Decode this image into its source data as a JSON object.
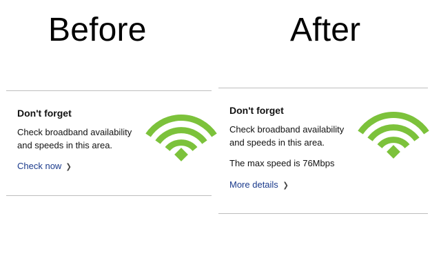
{
  "labels": {
    "before": "Before",
    "after": "After"
  },
  "before_card": {
    "title": "Don't forget",
    "text_line1": "Check broadband availability",
    "text_line2": "and speeds in this area.",
    "link": "Check now",
    "icon": "wifi-icon"
  },
  "after_card": {
    "title": "Don't forget",
    "text_line1": "Check broadband availability",
    "text_line2": "and speeds in this area.",
    "max_speed": "The max speed is 76Mbps",
    "link": "More details",
    "icon": "wifi-icon"
  },
  "colors": {
    "wifi_green": "#7cc23b",
    "link_blue": "#1a3a8c",
    "divider": "#bdbdbd"
  }
}
